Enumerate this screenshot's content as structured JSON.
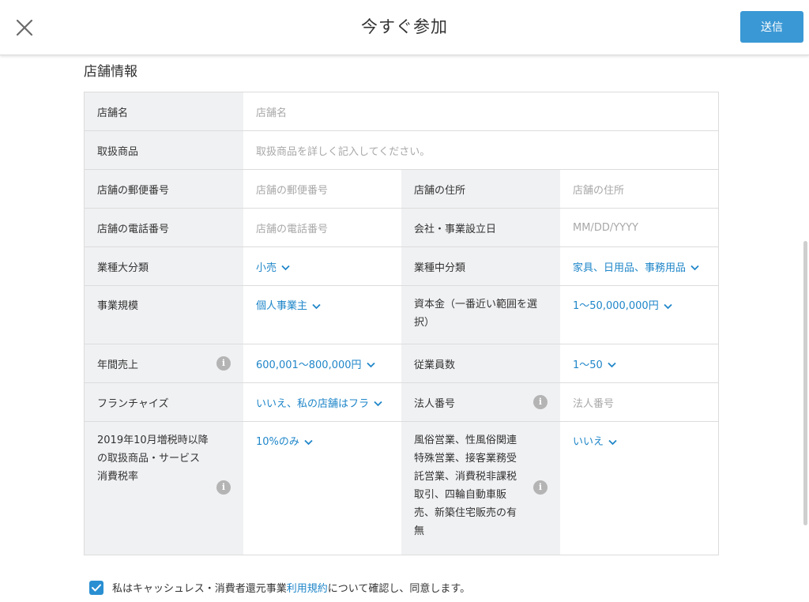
{
  "header": {
    "title": "今すぐ参加",
    "send_label": "送信"
  },
  "section": {
    "title": "店舗情報"
  },
  "form": {
    "store_name": {
      "label": "店舗名",
      "placeholder": "店舗名"
    },
    "products": {
      "label": "取扱商品",
      "placeholder": "取扱商品を詳しく記入してください。"
    },
    "postal_code": {
      "label": "店舗の郵便番号",
      "placeholder": "店舗の郵便番号"
    },
    "address": {
      "label": "店舗の住所",
      "placeholder": "店舗の住所"
    },
    "phone": {
      "label": "店舗の電話番号",
      "placeholder": "店舗の電話番号"
    },
    "established": {
      "label": "会社・事業設立日",
      "placeholder": "MM/DD/YYYY"
    },
    "industry_major": {
      "label": "業種大分類",
      "value": "小売"
    },
    "industry_middle": {
      "label": "業種中分類",
      "value": "家具、日用品、事務用品"
    },
    "business_scale": {
      "label": "事業規模",
      "value": "個人事業主"
    },
    "capital": {
      "label_line1": "資本金（一番近い範囲を選",
      "label_line2": "択）",
      "value": "1〜50,000,000円"
    },
    "annual_sales": {
      "label": "年間売上",
      "value": "600,001〜800,000円"
    },
    "employees": {
      "label": "従業員数",
      "value": "1〜50"
    },
    "franchise": {
      "label": "フランチャイズ",
      "value": "いいえ、私の店舗はフラ"
    },
    "corporate_number": {
      "label": "法人番号",
      "placeholder": "法人番号"
    },
    "tax_rate": {
      "label_line1": "2019年10月増税時以降",
      "label_line2": "の取扱商品・サービス",
      "label_line3": "消費税率",
      "value": "10%のみ"
    },
    "special_business": {
      "label_line1": "風俗営業、性風俗関連",
      "label_line2": "特殊営業、接客業務受",
      "label_line3": "託営業、消費税非課税",
      "label_line4": "取引、四輪自動車販",
      "label_line5": "売、新築住宅販売の有",
      "label_line6": "無",
      "value": "いいえ"
    }
  },
  "agreement": {
    "text_before": "私はキャッシュレス・消費者還元事業",
    "link": "利用規約",
    "text_after": "について確認し、同意します。",
    "checked": true
  },
  "colors": {
    "accent": "#3a98d5",
    "link": "#1f86c9",
    "label_bg": "#f0f1f3",
    "border": "#dcdcdc"
  },
  "icons": {
    "close": "close-icon",
    "chevron": "chevron-down-icon",
    "info": "info-icon",
    "check": "check-icon"
  }
}
